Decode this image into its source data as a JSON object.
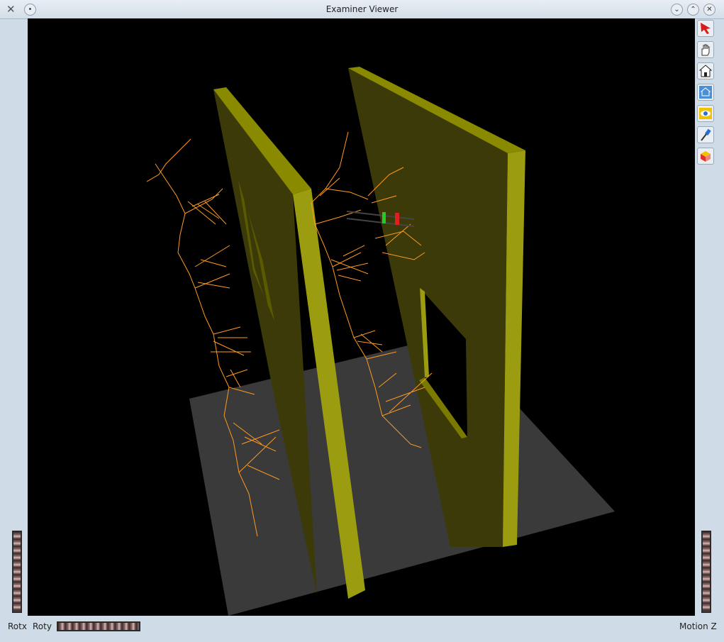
{
  "window": {
    "title": "Examiner Viewer",
    "app_icon": "x-icon",
    "controls": [
      "minimize-icon",
      "maximize-icon",
      "close-icon"
    ]
  },
  "toolbar": {
    "tools": [
      {
        "name": "select-arrow-icon",
        "color": "#d81a1a"
      },
      {
        "name": "hand-icon",
        "color": "#333333"
      },
      {
        "name": "home-icon",
        "color": "#222222"
      },
      {
        "name": "set-home-icon",
        "color": "#4a90d9"
      },
      {
        "name": "view-all-icon",
        "color": "#f2c200"
      },
      {
        "name": "seek-icon",
        "color": "#2a6fd6"
      },
      {
        "name": "projection-icon",
        "color": "#e03030"
      }
    ]
  },
  "bottom": {
    "rotx_label": "Rotx",
    "roty_label": "Roty",
    "motionz_label": "Motion Z"
  },
  "scene": {
    "background": "#000000",
    "floor_color": "#3a3a3a",
    "wall_color": "#7a7a00",
    "wall_side_color": "#9a9a10",
    "trace_color": "#ff9a20"
  }
}
